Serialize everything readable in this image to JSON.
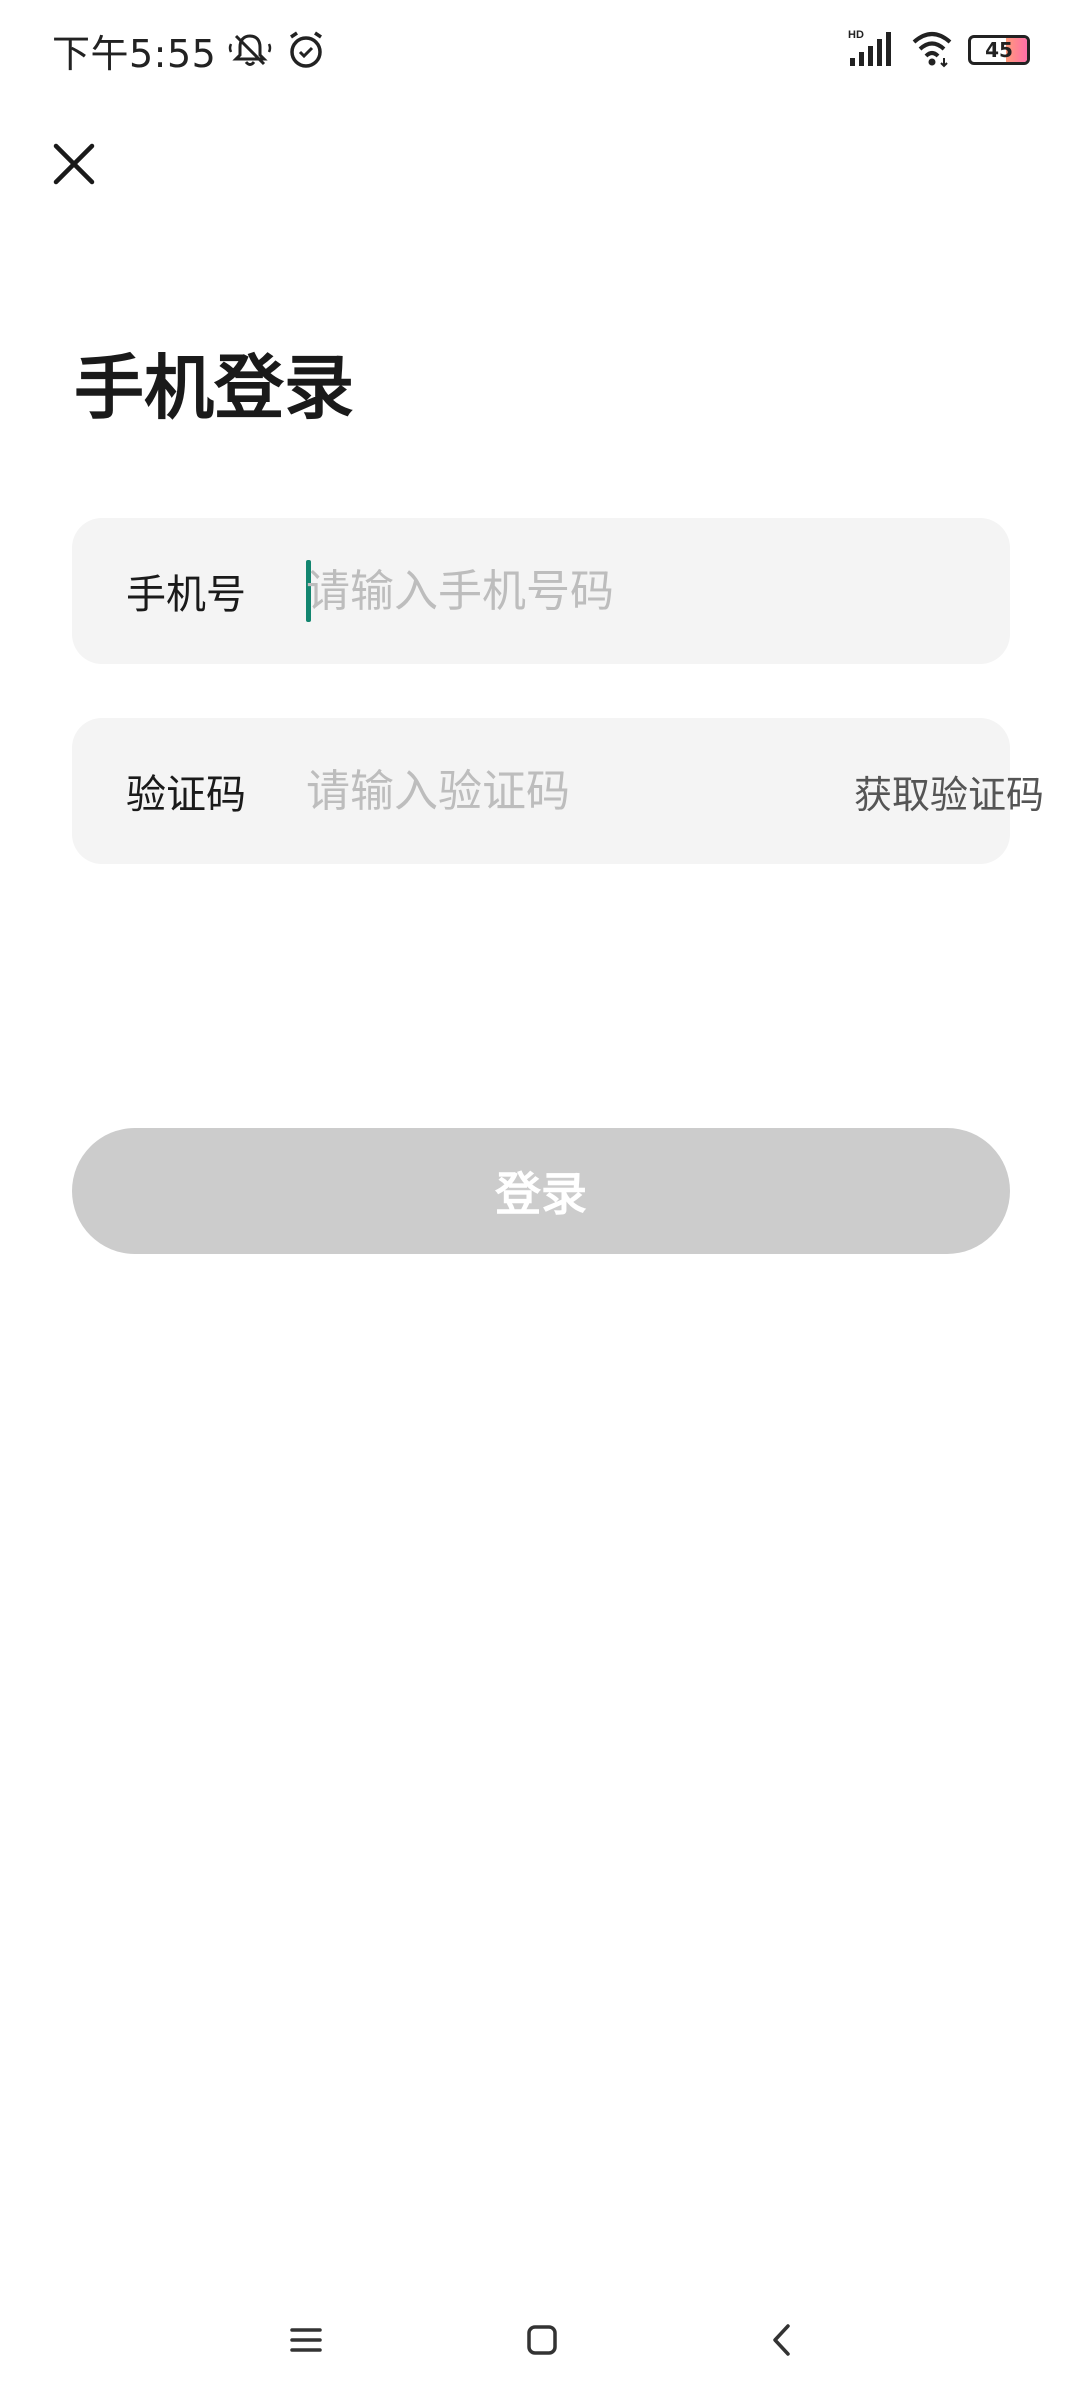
{
  "status_bar": {
    "time": "下午5:55",
    "battery_level": "45",
    "icons": [
      "bell-muted-icon",
      "alarm-icon",
      "hd-signal-icon",
      "wifi-icon",
      "battery-icon"
    ]
  },
  "header": {
    "close_icon": "close-icon"
  },
  "page": {
    "title": "手机登录"
  },
  "form": {
    "phone": {
      "label": "手机号",
      "value": "",
      "placeholder": "请输入手机号码"
    },
    "code": {
      "label": "验证码",
      "value": "",
      "placeholder": "请输入验证码",
      "get_code_label": "获取验证码"
    },
    "submit_label": "登录"
  },
  "nav_bar": {
    "icons": [
      "menu-icon",
      "home-icon",
      "back-icon"
    ]
  },
  "colors": {
    "accent": "#12856f",
    "field_bg": "#f4f4f4",
    "button_disabled": "#cccccc",
    "placeholder": "#bdbdbd"
  }
}
